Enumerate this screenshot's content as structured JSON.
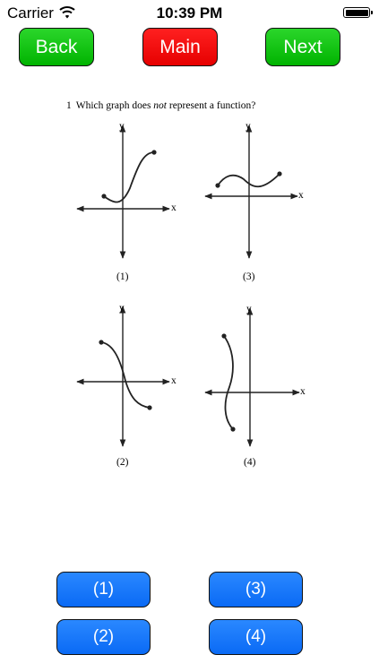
{
  "status_bar": {
    "carrier": "Carrier",
    "time": "10:39 PM"
  },
  "nav": {
    "back": "Back",
    "main": "Main",
    "next": "Next",
    "colors": {
      "back": "#00b300",
      "main": "#e60000",
      "next": "#00b300"
    }
  },
  "question": {
    "number": "1",
    "text_before": "Which graph does",
    "text_emphasis": "not",
    "text_after": "represent a function?"
  },
  "graphs": [
    {
      "label": "(1)",
      "x_axis": "x",
      "y_axis": "y"
    },
    {
      "label": "(3)",
      "x_axis": "x",
      "y_axis": "y"
    },
    {
      "label": "(2)",
      "x_axis": "x",
      "y_axis": "y"
    },
    {
      "label": "(4)",
      "x_axis": "x",
      "y_axis": "y"
    }
  ],
  "answers": [
    "(1)",
    "(3)",
    "(2)",
    "(4)"
  ],
  "answer_color": "#0a6af5"
}
